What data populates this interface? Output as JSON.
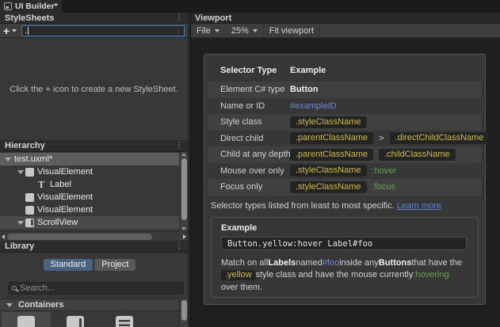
{
  "window": {
    "tab_title": "UI Builder*"
  },
  "stylesheets": {
    "title": "StyleSheets",
    "new_selector_value": ".",
    "empty_message": "Click the + icon to create a new StyleSheet."
  },
  "hierarchy": {
    "title": "Hierarchy",
    "items": [
      {
        "label": "test.uxml*",
        "depth": 0,
        "expander": true,
        "icon": null,
        "state": "selected"
      },
      {
        "label": "VisualElement",
        "depth": 1,
        "expander": true,
        "icon": "visual-element",
        "state": null
      },
      {
        "label": "Label",
        "depth": 2,
        "expander": false,
        "icon": "label",
        "state": null
      },
      {
        "label": "VisualElement",
        "depth": 1,
        "expander": false,
        "icon": "visual-element",
        "state": null
      },
      {
        "label": "VisualElement",
        "depth": 1,
        "expander": false,
        "icon": "visual-element",
        "state": null
      },
      {
        "label": "ScrollView",
        "depth": 1,
        "expander": true,
        "icon": "scroll-view",
        "state": "hover"
      },
      {
        "label": "",
        "depth": 1,
        "expander": false,
        "icon": "visual-element",
        "state": null
      }
    ]
  },
  "library": {
    "title": "Library",
    "tabs": [
      {
        "label": "Standard",
        "selected": true
      },
      {
        "label": "Project",
        "selected": false
      }
    ],
    "search_placeholder": "Search...",
    "section_label": "Containers",
    "tiles": [
      {
        "icon": "visual-element-icon",
        "state": "hover"
      },
      {
        "icon": "scroll-view-icon",
        "state": null
      },
      {
        "icon": "list-view-icon",
        "state": null
      }
    ]
  },
  "viewport": {
    "title": "Viewport",
    "toolbar": {
      "file_menu": "File",
      "zoom_level": "25%",
      "fit_button": "Fit viewport"
    }
  },
  "selector_help": {
    "columns": [
      "Selector Type",
      "Example"
    ],
    "rows": [
      {
        "label": "Element C# type",
        "parts": [
          {
            "style": "bold",
            "text": "Button"
          }
        ]
      },
      {
        "label": "Name or ID",
        "parts": [
          {
            "style": "id",
            "text": "#exampleID"
          }
        ]
      },
      {
        "label": "Style class",
        "parts": [
          {
            "style": "chip",
            "text": ".styleClassName"
          }
        ]
      },
      {
        "label": "Direct child",
        "parts": [
          {
            "style": "chip",
            "text": ".parentClassName"
          },
          {
            "style": "sep",
            "text": ">"
          },
          {
            "style": "chip",
            "text": ".directChildClassName"
          }
        ]
      },
      {
        "label": "Child at any depth",
        "parts": [
          {
            "style": "chip",
            "text": ".parentClassName"
          },
          {
            "style": "chip",
            "text": ".childClassName"
          }
        ]
      },
      {
        "label": "Mouse over only",
        "parts": [
          {
            "style": "chip",
            "text": ".styleClassName"
          },
          {
            "style": "pseudo",
            "text": ":hover"
          }
        ]
      },
      {
        "label": "Focus only",
        "parts": [
          {
            "style": "chip",
            "text": ".styleClassName"
          },
          {
            "style": "pseudo",
            "text": ":focus"
          }
        ]
      }
    ],
    "note_text": "Selector types listed from least to most specific.",
    "note_link": "Learn more",
    "example_title": "Example",
    "example_code": "Button.yellow:hover Label#foo",
    "example_desc_lines": [
      [
        {
          "style": "plain",
          "text": "Match on all "
        },
        {
          "style": "bold",
          "text": "Labels"
        },
        {
          "style": "plain",
          "text": " named "
        },
        {
          "style": "id",
          "text": "#foo"
        },
        {
          "style": "plain",
          "text": " inside any "
        },
        {
          "style": "bold",
          "text": "Buttons"
        },
        {
          "style": "plain",
          "text": " that have the"
        }
      ],
      [
        {
          "style": "chip",
          "text": ".yellow"
        },
        {
          "style": "plain",
          "text": " style class and have the mouse currently "
        },
        {
          "style": "pseudo",
          "text": ":hovering"
        }
      ],
      [
        {
          "style": "plain",
          "text": "over them."
        }
      ]
    ]
  },
  "colors": {
    "selection_blue": "#48627f",
    "focus_border": "#3d7dbd",
    "chip_text": "#ccba50",
    "pseudo_green": "#67a04f",
    "id_blue": "#7583d8",
    "link_blue": "#5583de"
  }
}
